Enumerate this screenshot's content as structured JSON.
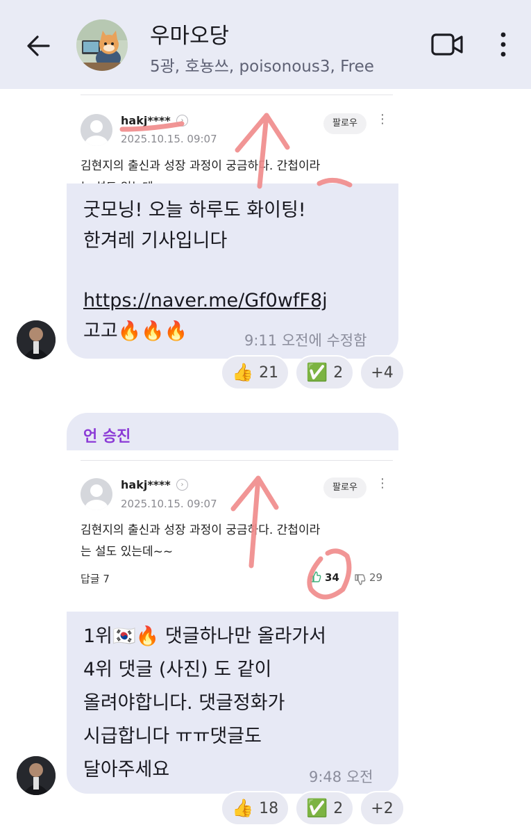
{
  "header": {
    "back_icon": "arrow-left-icon",
    "title": "우마오당",
    "subtitle": "5광, 호뇽쓰, poisonous3, Free",
    "video_icon": "video-call-icon",
    "more_icon": "more-vertical-icon"
  },
  "messages": [
    {
      "embed": {
        "username": "hakj****",
        "date": "2025.10.15. 09:07",
        "follow_label": "팔로우",
        "body": "김현지의 출신과 성장 과정이 궁금하다. 간첩이라\n는 설도 있는데~"
      },
      "line1": "굿모닝! 오늘 하루도 화이팅!",
      "line2": "한겨레 기사입니다",
      "link": "https://naver.me/Gf0wfF8j",
      "line4": "고고🔥🔥🔥",
      "time": "9:11 오전에 수정함",
      "reactions": [
        {
          "emoji": "👍",
          "count": "21"
        },
        {
          "emoji": "✅",
          "count": "2"
        },
        {
          "label": "+4"
        }
      ]
    },
    {
      "reply_to": "언 승진",
      "embed": {
        "username": "hakj****",
        "date": "2025.10.15. 09:07",
        "follow_label": "팔로우",
        "body": "김현지의 출신과 성장 과정이 궁금하다. 간첩이라\n는 설도 있는데~~",
        "reply_label": "답글 7",
        "likes": "34",
        "dislikes": "29"
      },
      "text": "1위🇰🇷🔥 댓글하나만 올라가서\n4위 댓글 (사진) 도 같이\n올려야합니다. 댓글정화가\n시급합니다 ㅠㅠ댓글도\n달아주세요",
      "time": "9:48 오전",
      "reactions": [
        {
          "emoji": "👍",
          "count": "18"
        },
        {
          "emoji": "✅",
          "count": "2"
        },
        {
          "label": "+2"
        }
      ]
    }
  ],
  "colors": {
    "header_bg": "#e9ebf5",
    "bubble_bg": "#e7e9f5",
    "reply_name": "#8b3ad6",
    "annotation": "#f08a8a"
  }
}
